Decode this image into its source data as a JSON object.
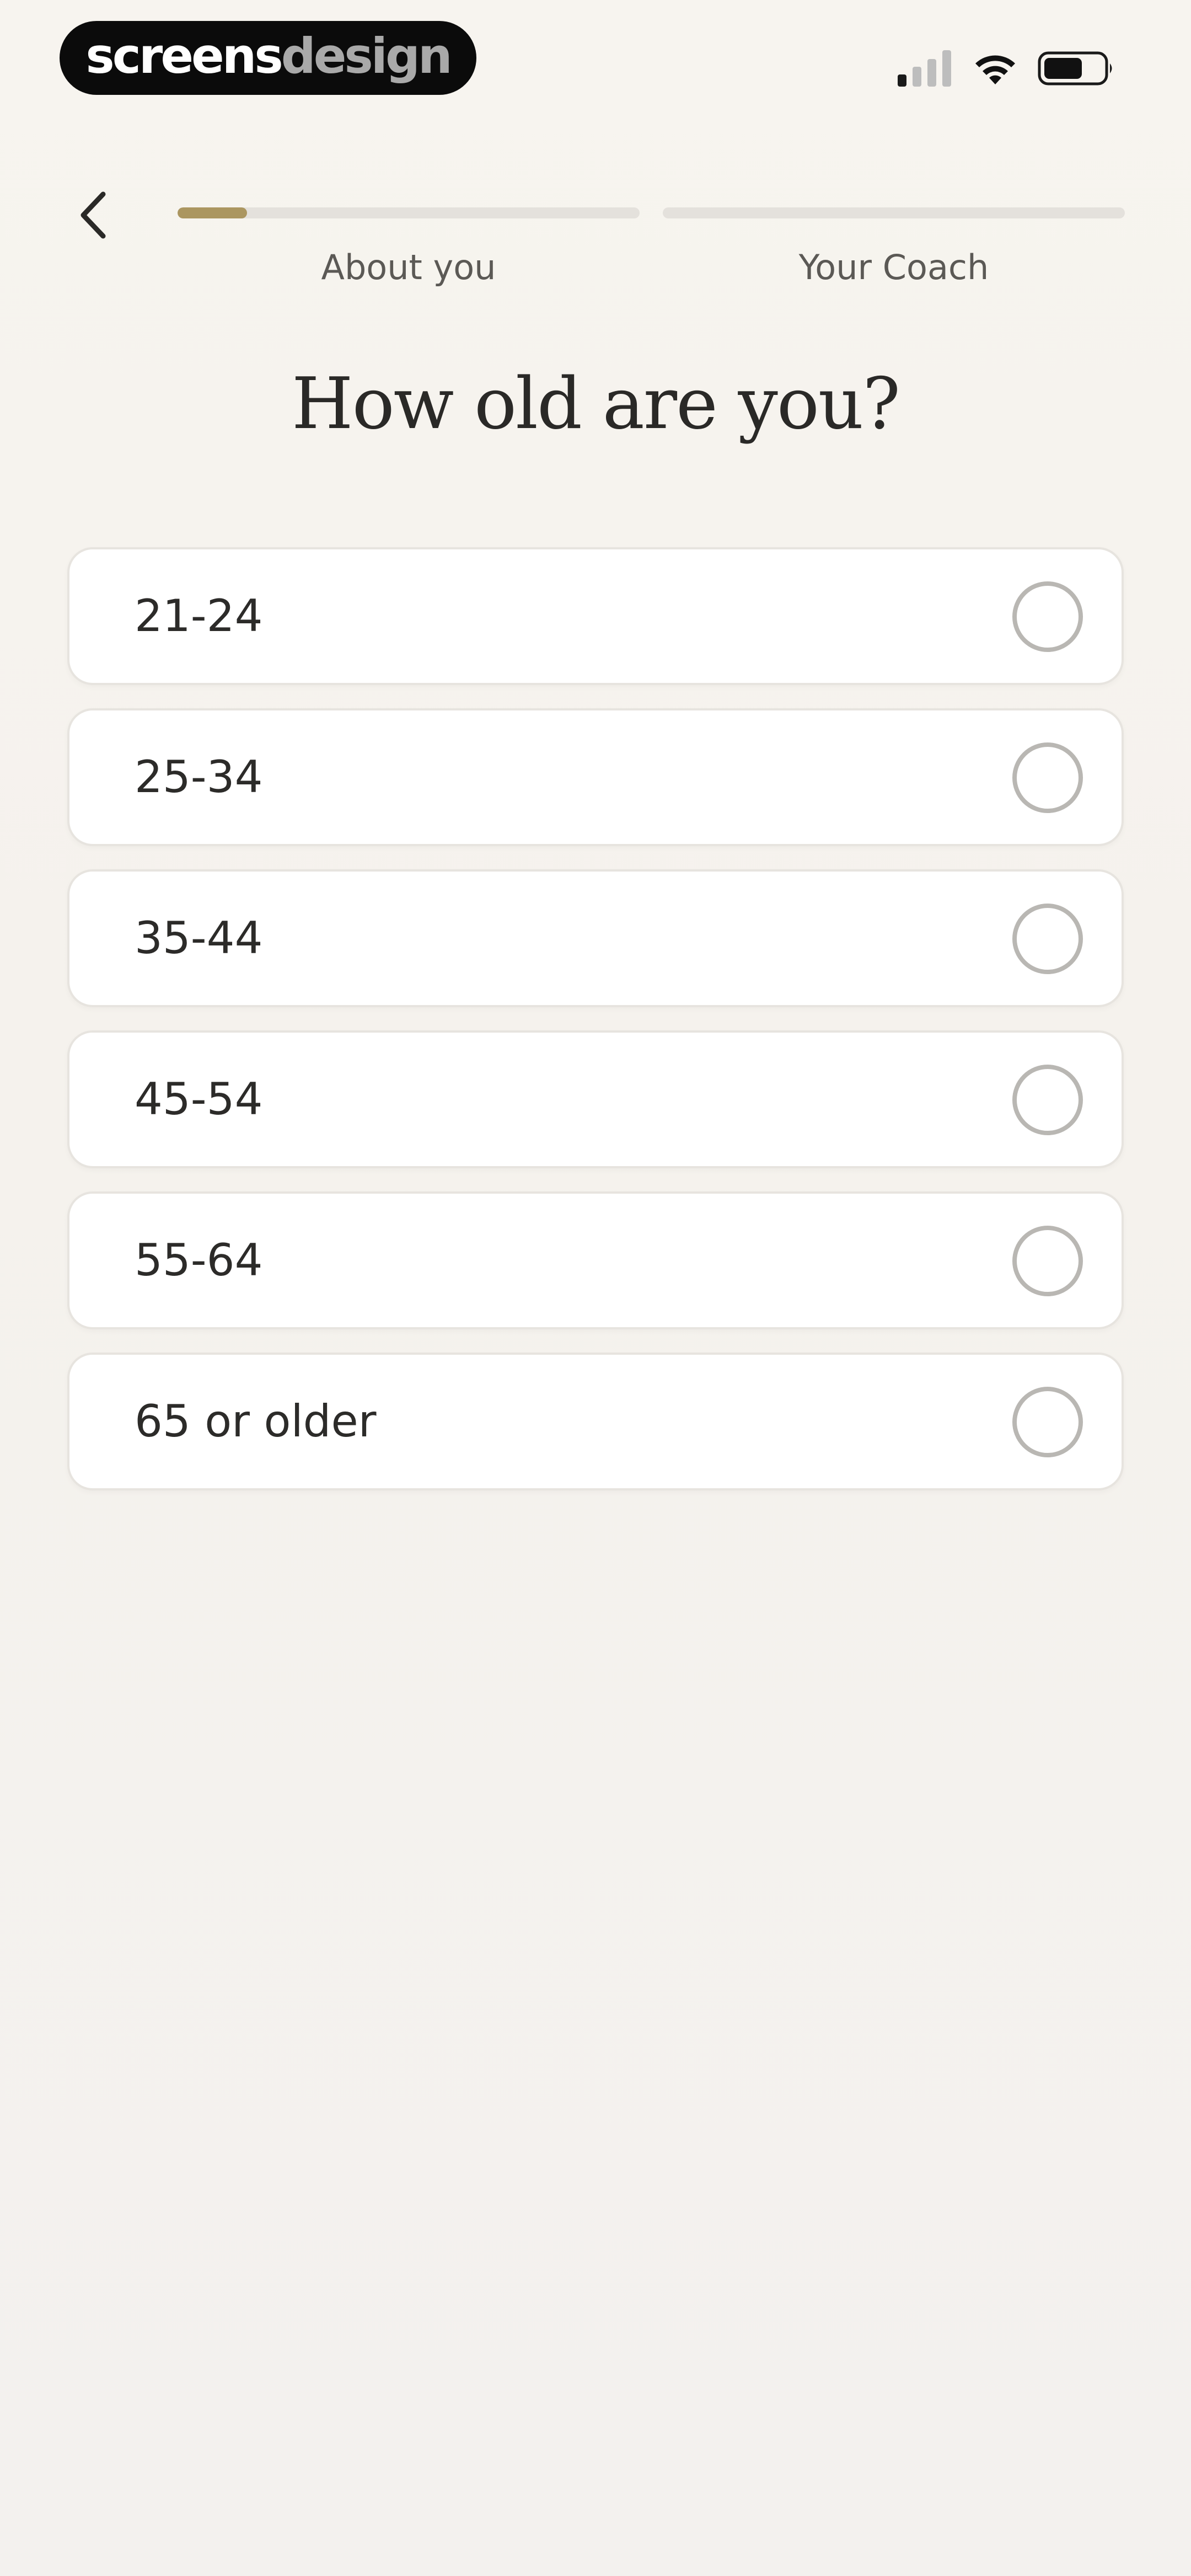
{
  "status_bar": {
    "brand_part1": "screens",
    "brand_part2": "design",
    "icons": [
      "signal-icon",
      "wifi-icon",
      "battery-icon"
    ]
  },
  "header": {
    "back_icon": "chevron-left-icon",
    "steps": [
      {
        "label": "About you",
        "progress": 0.15
      },
      {
        "label": "Your Coach",
        "progress": 0
      }
    ]
  },
  "title": "How old are you?",
  "options": [
    {
      "label": "21-24",
      "selected": false
    },
    {
      "label": "25-34",
      "selected": false
    },
    {
      "label": "35-44",
      "selected": false
    },
    {
      "label": "45-54",
      "selected": false
    },
    {
      "label": "55-64",
      "selected": false
    },
    {
      "label": "65 or older",
      "selected": false
    }
  ],
  "colors": {
    "accent": "#ab9660",
    "background": "#f5f3ef",
    "card": "#ffffff",
    "text": "#2c2b29"
  }
}
